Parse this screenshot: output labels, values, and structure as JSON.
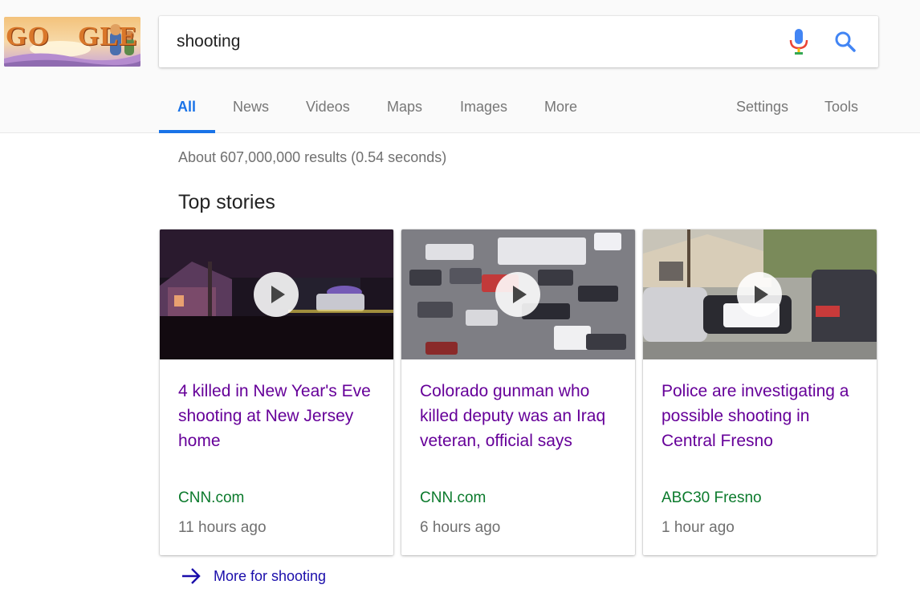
{
  "search": {
    "query": "shooting"
  },
  "doodle": {
    "text_left": "GO",
    "text_right": "GLE"
  },
  "tabs": [
    {
      "label": "All",
      "active": true
    },
    {
      "label": "News"
    },
    {
      "label": "Videos"
    },
    {
      "label": "Maps"
    },
    {
      "label": "Images"
    },
    {
      "label": "More"
    },
    {
      "label": "Settings"
    },
    {
      "label": "Tools"
    }
  ],
  "results": {
    "stats": "About 607,000,000 results (0.54 seconds)",
    "top_stories_heading": "Top stories",
    "stories": [
      {
        "title": "4 killed in New Year's Eve shooting at New Jersey home",
        "source": "CNN.com",
        "time": "11 hours ago"
      },
      {
        "title": "Colorado gunman who killed deputy was an Iraq veteran, official says",
        "source": "CNN.com",
        "time": "6 hours ago"
      },
      {
        "title": "Police are investigating a possible shooting in Central Fresno",
        "source": "ABC30 Fresno",
        "time": "1 hour ago"
      }
    ],
    "more_link": "More for shooting"
  },
  "colors": {
    "accent_blue": "#1a73e8",
    "visited_link": "#660099",
    "source_green": "#0b7a2c",
    "link_blue": "#1a0dab"
  },
  "icons": {
    "mic": "microphone-icon",
    "search": "search-icon",
    "play": "play-icon",
    "arrow": "arrow-right-icon"
  }
}
